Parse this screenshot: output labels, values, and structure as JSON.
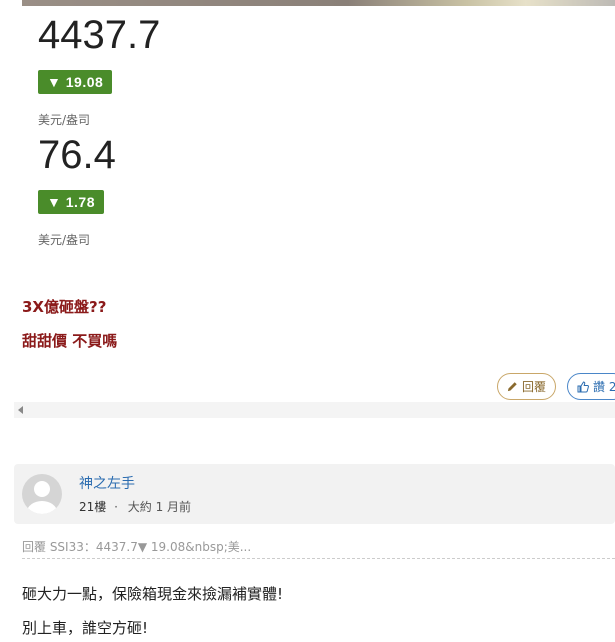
{
  "quotes": [
    {
      "price": "4437.7",
      "change": "▼ 19.08",
      "unit": "美元/盎司"
    },
    {
      "price": "76.4",
      "change": "▼ 1.78",
      "unit": "美元/盎司"
    }
  ],
  "post": {
    "line1": "3X億砸盤??",
    "line2": "甜甜價 不買嗎"
  },
  "actions": {
    "reply_label": "回覆",
    "like_label": "讚 2"
  },
  "comment": {
    "author": "神之左手",
    "floor": "21樓",
    "separator": "·",
    "time": "大約 1 月前",
    "reply_to": "回覆 SSI33：4437.7▼ 19.08&nbsp;美...",
    "lines": [
      "砸大力一點，保險箱現金來撿漏補實體!",
      "別上車，誰空方砸!"
    ]
  },
  "colors": {
    "badge_bg": "#4a8c2a",
    "post_text": "#8b1a1a",
    "link": "#2b6cb0",
    "reply_border": "#c9a769"
  }
}
